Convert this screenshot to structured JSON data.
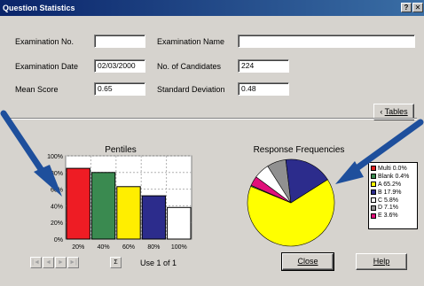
{
  "window": {
    "title": "Question Statistics",
    "help_glyph": "?",
    "close_glyph": "✕"
  },
  "form": {
    "exam_no_label": "Examination No.",
    "exam_no_value": "",
    "exam_name_label": "Examination Name",
    "exam_name_value": "",
    "exam_date_label": "Examination Date",
    "exam_date_value": "02/03/2000",
    "candidates_label": "No. of Candidates",
    "candidates_value": "224",
    "mean_label": "Mean Score",
    "mean_value": "0.65",
    "sd_label": "Standard Deviation",
    "sd_value": "0.48"
  },
  "buttons": {
    "tables_label": "Tables",
    "tables_arrow": "‹",
    "close_label": "Close",
    "help_label": "Help"
  },
  "nav": {
    "first": "|◄",
    "prev": "◄",
    "next": "►",
    "last": "►|",
    "sum": "Σ",
    "status": "Use 1 of 1"
  },
  "chart_data": [
    {
      "type": "bar",
      "title": "Pentiles",
      "categories": [
        "20%",
        "40%",
        "60%",
        "80%",
        "100%"
      ],
      "values": [
        85,
        80,
        63,
        52,
        38
      ],
      "ylim": [
        0,
        100
      ],
      "yticks": [
        "0%",
        "20%",
        "40%",
        "60%",
        "80%",
        "100%"
      ],
      "grid": true,
      "colors": [
        "#ee1c24",
        "#3a8a50",
        "#ffee00",
        "#2c2c8c",
        "#ffffff"
      ]
    },
    {
      "type": "pie",
      "title": "Response Frequencies",
      "legend_position": "right",
      "slices": [
        {
          "label": "Multi 0.0%",
          "value": 0.0,
          "color": "#e02020"
        },
        {
          "label": "Blank 0.4%",
          "value": 0.4,
          "color": "#3a8a50"
        },
        {
          "label": "A 65.2%",
          "value": 65.2,
          "color": "#ffff00"
        },
        {
          "label": "B 17.9%",
          "value": 17.9,
          "color": "#2c2c8c"
        },
        {
          "label": "C 5.8%",
          "value": 5.8,
          "color": "#ffffff"
        },
        {
          "label": "D 7.1%",
          "value": 7.1,
          "color": "#909090"
        },
        {
          "label": "E 3.6%",
          "value": 3.6,
          "color": "#e0107a"
        }
      ]
    }
  ],
  "colors": {
    "arrow": "#1e4f9c",
    "titlebar_start": "#0a246a",
    "titlebar_end": "#3a6ea5",
    "dialog_bg": "#d6d3ce"
  }
}
